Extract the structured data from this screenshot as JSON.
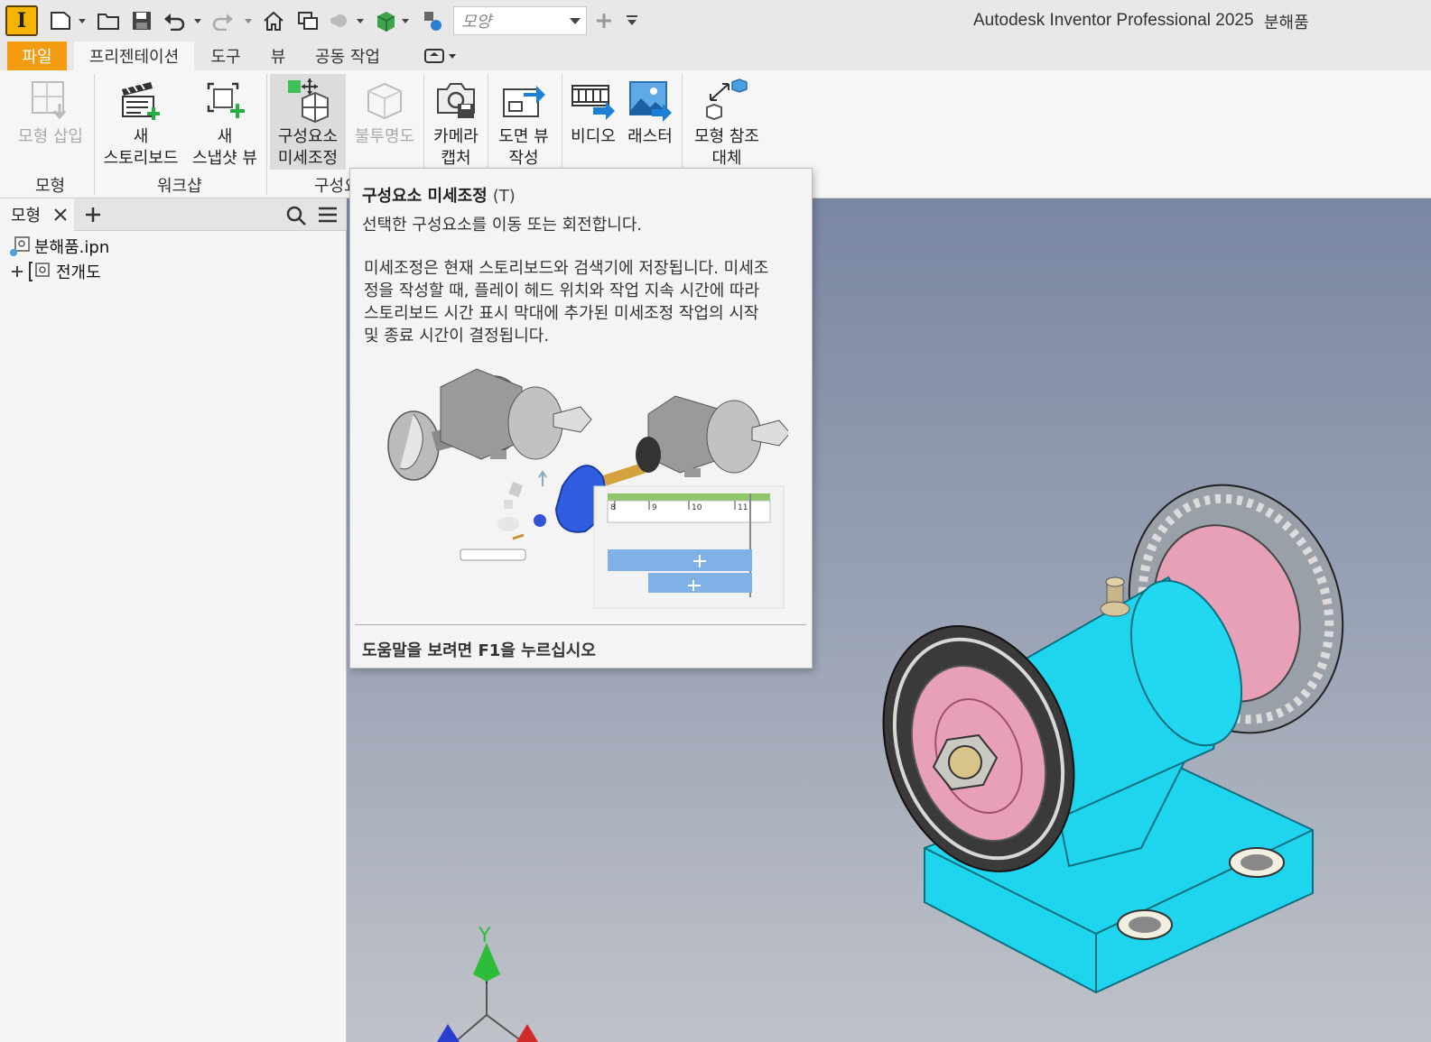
{
  "app": {
    "title": "Autodesk Inventor Professional 2025",
    "document": "분해품",
    "logo_letter": "I"
  },
  "quick_access": {
    "appearance_placeholder": "모양",
    "icons": [
      "new-icon",
      "open-icon",
      "save-icon",
      "undo-icon",
      "redo-icon",
      "home-icon",
      "window-icon",
      "material-icon",
      "appearance-icon",
      "adjust-icon",
      "add-icon",
      "customize-icon"
    ]
  },
  "ribbon_tabs": [
    {
      "label": "파일",
      "key": "file"
    },
    {
      "label": "프리젠테이션",
      "key": "presentation",
      "active": true
    },
    {
      "label": "도구",
      "key": "tools"
    },
    {
      "label": "뷰",
      "key": "view"
    },
    {
      "label": "공동 작업",
      "key": "collaborate"
    }
  ],
  "ribbon": {
    "insert_model": {
      "label": "모형 삽입"
    },
    "new_storyboard": {
      "line1": "새",
      "line2": "스토리보드"
    },
    "new_snapshot": {
      "line1": "새",
      "line2": "스냅샷 뷰"
    },
    "tweak": {
      "line1": "구성요소",
      "line2": "미세조정"
    },
    "opacity": {
      "label": "불투명도"
    },
    "capture_camera": {
      "line1": "카메라",
      "line2": "캡처"
    },
    "drawing_view": {
      "line1": "도면 뷰",
      "line2": "작성"
    },
    "video": {
      "label": "비디오"
    },
    "raster": {
      "label": "래스터"
    },
    "replace_model": {
      "line1": "모형 참조",
      "line2": "대체"
    },
    "groups": {
      "model": "모형",
      "workshop": "워크샵",
      "component": "구성요"
    }
  },
  "browser": {
    "tab_label": "모형",
    "items": [
      {
        "label": "분해품.ipn"
      },
      {
        "label": "전개도"
      }
    ]
  },
  "tooltip": {
    "title": "구성요소 미세조정",
    "shortcut": "(T)",
    "description": "선택한 구성요소를 이동 또는 회전합니다.",
    "body_lines": [
      "미세조정은 현재 스토리보드와 검색기에 저장됩니다. 미세조",
      "정을 작성할 때, 플레이 헤드 위치와 작업 지속 시간에 따라",
      "스토리보드 시간 표시 막대에 추가된 미세조정 작업의 시작",
      "및 종료 시간이 결정됩니다."
    ],
    "help_text": "도움말을 보려면 F1을 누르십시오",
    "timeline_ticks": [
      "8",
      "9",
      "10",
      "11"
    ]
  },
  "viewport": {
    "axis_label": "Y",
    "colors": {
      "body": "#1fd5ee",
      "pulley": "#3a3a3a",
      "gear": "#a0a4ac",
      "pink": "#e8a0b8"
    }
  }
}
